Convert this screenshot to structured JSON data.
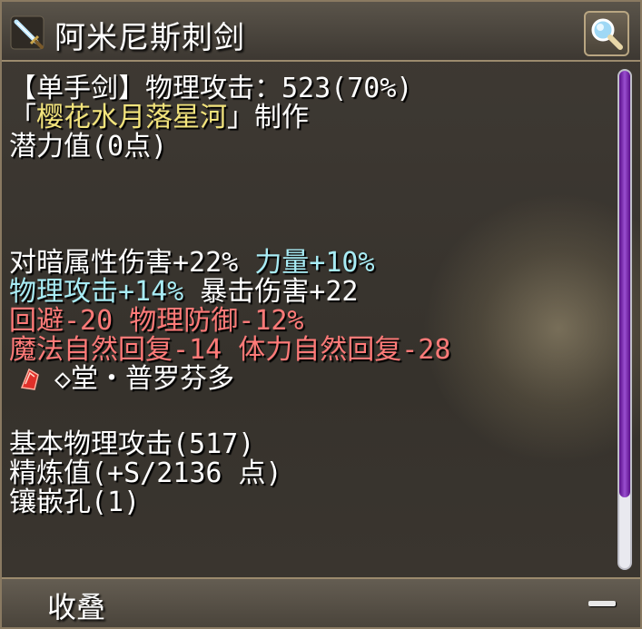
{
  "window": {
    "title": "阿米尼斯刺剑",
    "title_icon": "sword-icon",
    "search_icon": "magnifier-icon"
  },
  "item": {
    "lines": {
      "type_attack": "【单手剑】物理攻击：523(70%)",
      "maker_open": "「",
      "maker_name": "樱花水月落星河",
      "maker_close": "」制作",
      "potential": "潜力值(0点)",
      "stat_dark": "对暗属性伤害+22% ",
      "stat_str": "力量+10%",
      "stat_patk": "物理攻击+14%",
      "stat_crit": " 暴击伤害+22",
      "stat_neg1": "回避-20 物理防御-12%",
      "stat_neg2": "魔法自然回复-14 体力自然回复-28",
      "crystal": "◇堂・普罗芬多",
      "base_atk": "基本物理攻击(517)",
      "refine": "精炼值(+S/2136 点)",
      "slots": "镶嵌孔(1)"
    },
    "crystal_icon": "red-gem-icon"
  },
  "footer": {
    "label": "收叠",
    "collapse_icon": "minus-icon"
  },
  "colors": {
    "highlight": "#f3e47c",
    "positive": "#a8ecf5",
    "negative": "#ff7a78",
    "scroll_thumb": "#8a3fc0"
  }
}
